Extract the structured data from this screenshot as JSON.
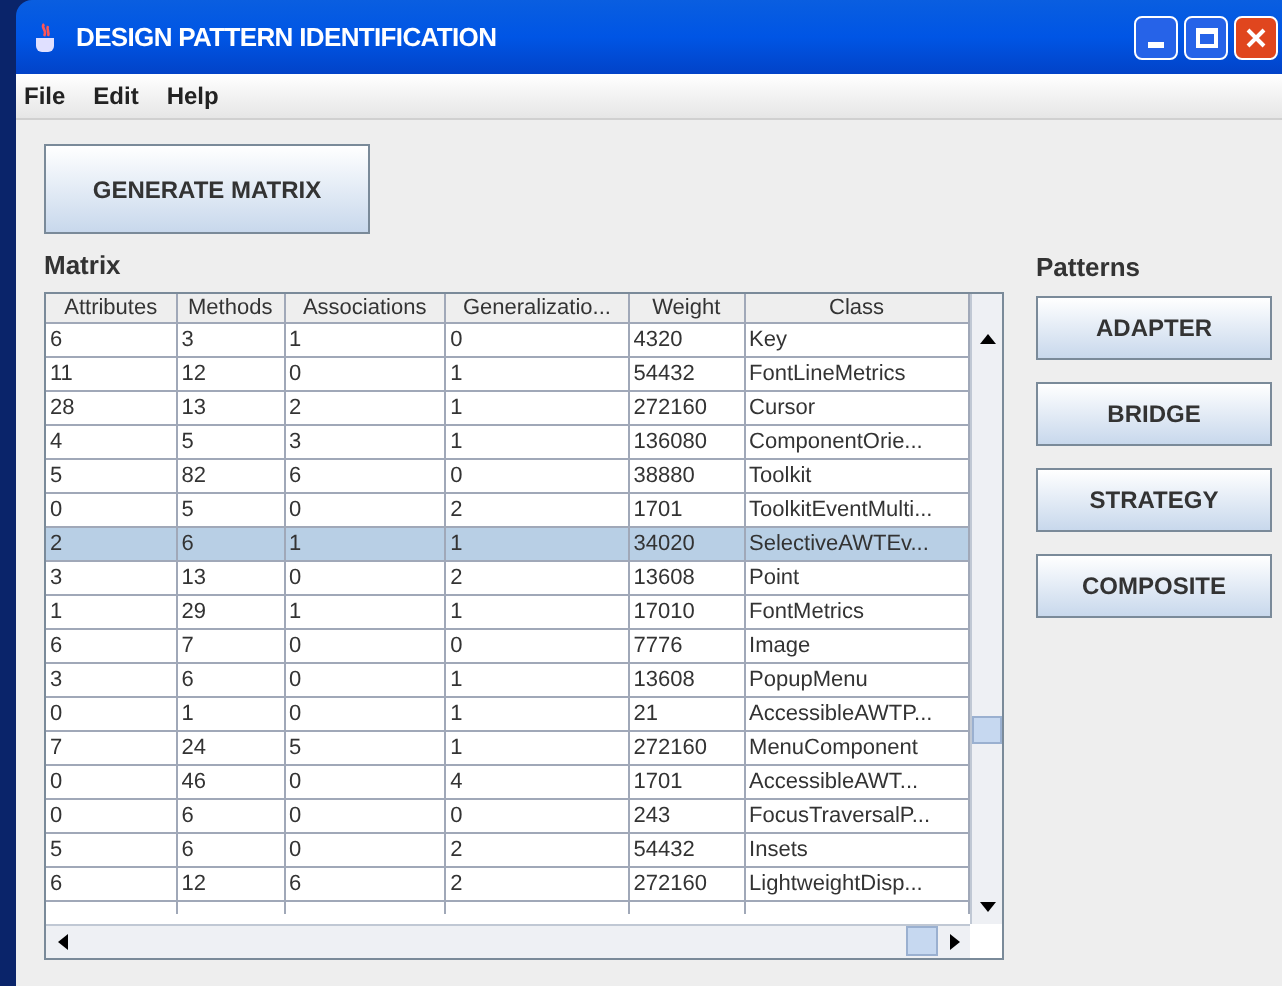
{
  "window": {
    "title": "DESIGN PATTERN IDENTIFICATION"
  },
  "menu": [
    "File",
    "Edit",
    "Help"
  ],
  "generate_button": "GENERATE MATRIX",
  "matrix": {
    "title": "Matrix",
    "columns": [
      "Attributes",
      "Methods",
      "Associations",
      "Generalizatio...",
      "Weight",
      "Class"
    ],
    "rows": [
      {
        "cells": [
          "6",
          "3",
          "1",
          "0",
          "4320",
          "Key"
        ],
        "selected": false
      },
      {
        "cells": [
          "11",
          "12",
          "0",
          "1",
          "54432",
          "FontLineMetrics"
        ],
        "selected": false
      },
      {
        "cells": [
          "28",
          "13",
          "2",
          "1",
          "272160",
          "Cursor"
        ],
        "selected": false
      },
      {
        "cells": [
          "4",
          "5",
          "3",
          "1",
          "136080",
          "ComponentOrie..."
        ],
        "selected": false
      },
      {
        "cells": [
          "5",
          "82",
          "6",
          "0",
          "38880",
          "Toolkit"
        ],
        "selected": false
      },
      {
        "cells": [
          "0",
          "5",
          "0",
          "2",
          "1701",
          "ToolkitEventMulti..."
        ],
        "selected": false
      },
      {
        "cells": [
          "2",
          "6",
          "1",
          "1",
          "34020",
          "SelectiveAWTEv..."
        ],
        "selected": true
      },
      {
        "cells": [
          "3",
          "13",
          "0",
          "2",
          "13608",
          "Point"
        ],
        "selected": false
      },
      {
        "cells": [
          "1",
          "29",
          "1",
          "1",
          "17010",
          "FontMetrics"
        ],
        "selected": false
      },
      {
        "cells": [
          "6",
          "7",
          "0",
          "0",
          "7776",
          "Image"
        ],
        "selected": false
      },
      {
        "cells": [
          "3",
          "6",
          "0",
          "1",
          "13608",
          "PopupMenu"
        ],
        "selected": false
      },
      {
        "cells": [
          "0",
          "1",
          "0",
          "1",
          "21",
          "AccessibleAWTP..."
        ],
        "selected": false
      },
      {
        "cells": [
          "7",
          "24",
          "5",
          "1",
          "272160",
          "MenuComponent"
        ],
        "selected": false
      },
      {
        "cells": [
          "0",
          "46",
          "0",
          "4",
          "1701",
          "AccessibleAWT..."
        ],
        "selected": false
      },
      {
        "cells": [
          "0",
          "6",
          "0",
          "0",
          "243",
          "FocusTraversalP..."
        ],
        "selected": false
      },
      {
        "cells": [
          "5",
          "6",
          "0",
          "2",
          "54432",
          "Insets"
        ],
        "selected": false
      },
      {
        "cells": [
          "6",
          "12",
          "6",
          "2",
          "272160",
          "LightweightDisp..."
        ],
        "selected": false
      }
    ]
  },
  "patterns": {
    "title": "Patterns",
    "buttons": [
      "ADAPTER",
      "BRIDGE",
      "STRATEGY",
      "COMPOSITE"
    ]
  }
}
